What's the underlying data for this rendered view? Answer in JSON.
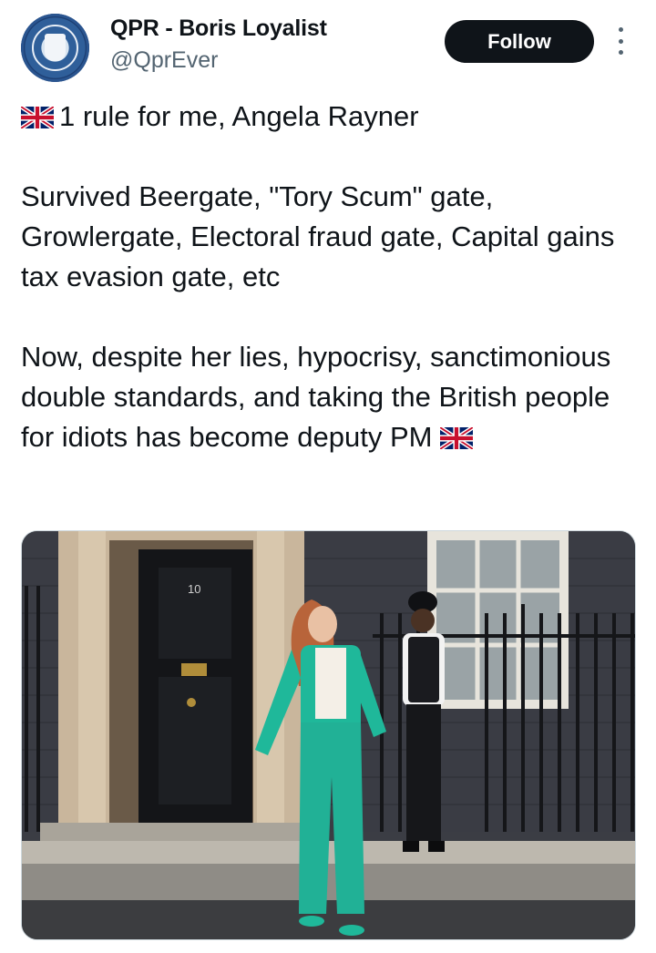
{
  "author": {
    "display_name": "QPR - Boris Loyalist",
    "handle": "@QprEver",
    "avatar_icon": "club-crest-avatar"
  },
  "actions": {
    "follow_label": "Follow",
    "more_icon": "more-vertical-icon"
  },
  "tweet": {
    "line1": "1 rule for me, Angela Rayner",
    "para2": "Survived Beergate, \"Tory Scum\" gate, Growlergate, Electoral fraud gate, Capital gains tax evasion gate, etc",
    "para3": "Now, despite her lies, hypocrisy, sanctimonious double standards, and taking the British people for idiots has become deputy PM",
    "flag_icon": "uk-flag-icon"
  },
  "media": {
    "door_number": "10",
    "description_icon": "downing-street-photo"
  },
  "colors": {
    "text": "#0f1419",
    "secondary_text": "#536471",
    "follow_bg": "#0f1419",
    "suit": "#1fb89a"
  }
}
